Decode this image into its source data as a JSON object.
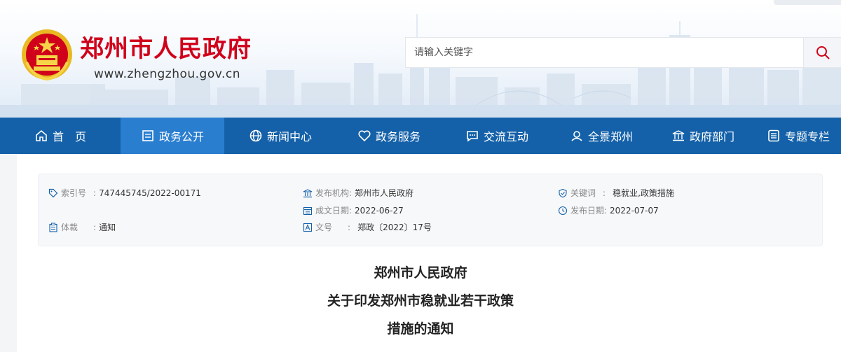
{
  "header": {
    "site_title": "郑州市人民政府",
    "site_url": "www.zhengzhou.gov.cn",
    "search_placeholder": "请输入关键字",
    "emblem_icon": "national-emblem-icon",
    "search_icon": "search-icon"
  },
  "nav": {
    "items": [
      {
        "label": "首　页",
        "icon": "home-icon",
        "active": false
      },
      {
        "label": "政务公开",
        "icon": "document-icon",
        "active": true
      },
      {
        "label": "新闻中心",
        "icon": "globe-icon",
        "active": false
      },
      {
        "label": "政务服务",
        "icon": "heart-icon",
        "active": false
      },
      {
        "label": "交流互动",
        "icon": "chat-icon",
        "active": false
      },
      {
        "label": "全景郑州",
        "icon": "location-icon",
        "active": false
      },
      {
        "label": "政府部门",
        "icon": "building-icon",
        "active": false
      },
      {
        "label": "专题专栏",
        "icon": "list-icon",
        "active": false
      }
    ]
  },
  "meta": {
    "index_label": "索引号",
    "index_value": "747445745/2022-00171",
    "publisher_label": "发布机构:",
    "publisher_value": "郑州市人民政府",
    "keywords_label": "关键词",
    "keywords_value": "稳就业,政策措施",
    "created_label": "成文日期:",
    "created_value": "2022-06-27",
    "published_label": "发布日期:",
    "published_value": "2022-07-07",
    "genre_label": "体裁",
    "genre_value": "通知",
    "docno_label": "文号",
    "docno_value": "郑政〔2022〕17号"
  },
  "document": {
    "title_line1": "郑州市人民政府",
    "title_line2": "关于印发郑州市稳就业若干政策",
    "title_line3": "措施的通知"
  },
  "colors": {
    "nav_bg": "#1461a9",
    "nav_active": "#2a7ed0",
    "title_red": "#d0021b"
  }
}
